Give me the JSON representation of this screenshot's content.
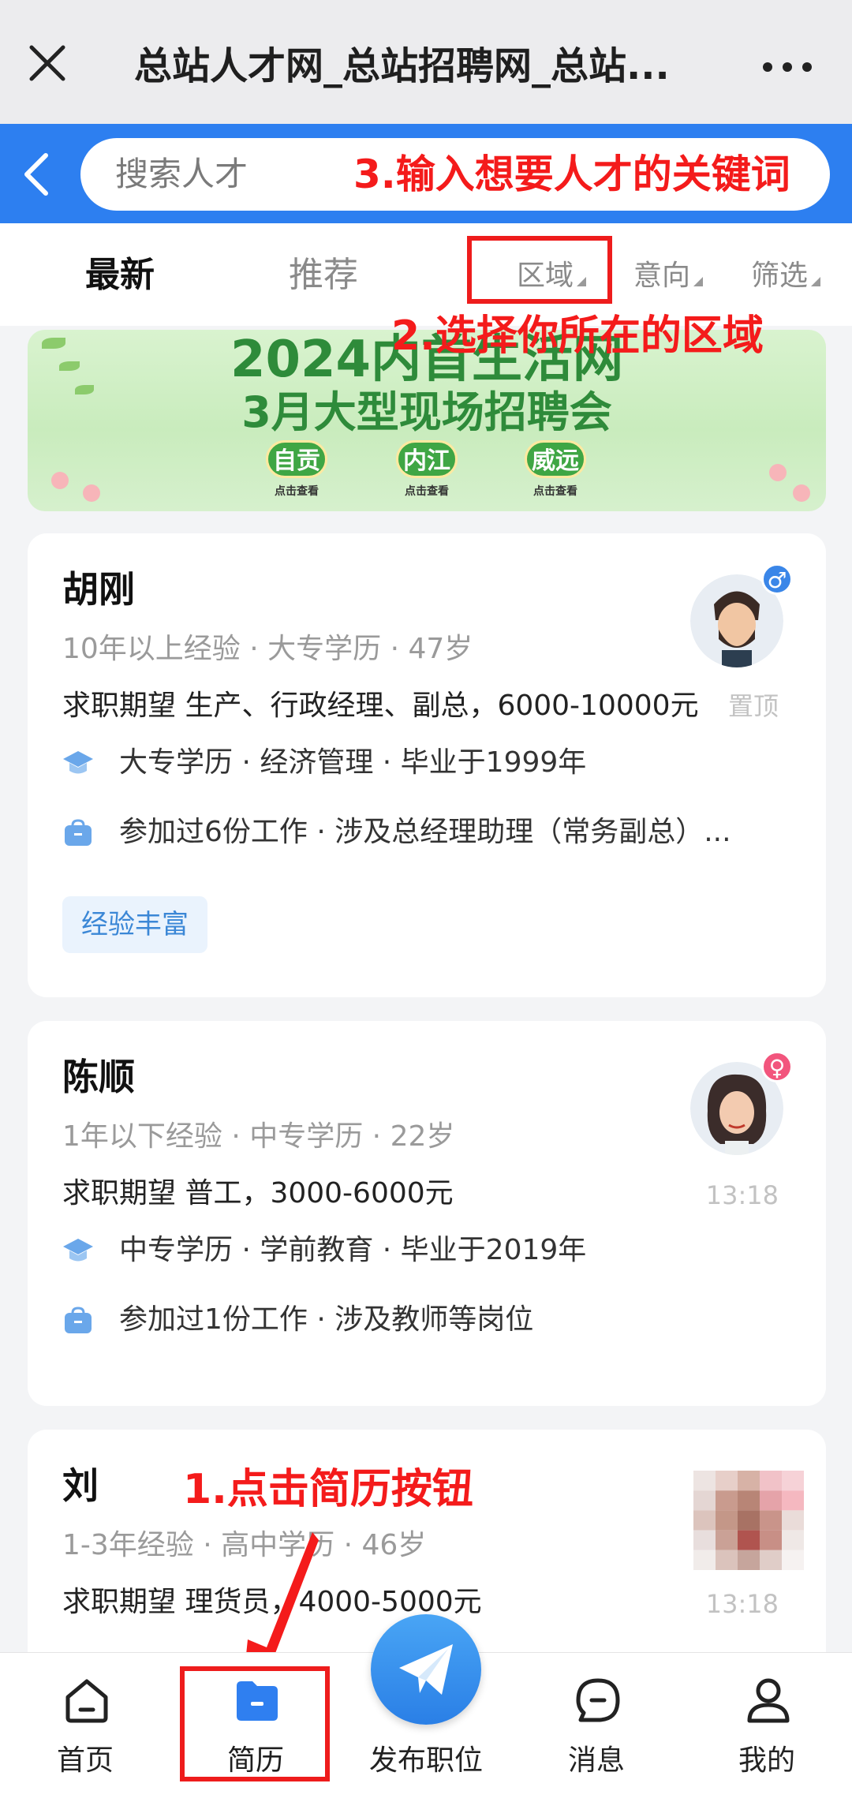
{
  "titlebar": {
    "title": "总站人才网_总站招聘网_总站..."
  },
  "search": {
    "placeholder": "搜索人才"
  },
  "tabs": {
    "latest": "最新",
    "recommended": "推荐"
  },
  "filters": {
    "area": "区域",
    "intent": "意向",
    "screen": "筛选"
  },
  "annotations": {
    "step1": "1.点击简历按钮",
    "step2": "2.选择你所在的区域",
    "step3": "3.输入想要人才的关键词"
  },
  "banner": {
    "line1": "2024内首生活网",
    "line2": "3月大型现场招聘会",
    "cities": [
      "自贡",
      "内江",
      "威远"
    ],
    "city_sub": "点击查看"
  },
  "candidates": [
    {
      "name": "胡刚",
      "meta": "10年以上经验 · 大专学历 · 47岁",
      "expect": "求职期望 生产、行政经理、副总，6000-10000元",
      "status": "置顶",
      "education": "大专学历 · 经济管理 · 毕业于1999年",
      "work": "参加过6份工作 · 涉及总经理助理（常务副总）...",
      "tag": "经验丰富",
      "gender": "♂"
    },
    {
      "name": "陈顺",
      "meta": "1年以下经验 · 中专学历 · 22岁",
      "expect": "求职期望 普工，3000-6000元",
      "status": "13:18",
      "education": "中专学历 · 学前教育 · 毕业于2019年",
      "work": "参加过1份工作 · 涉及教师等岗位",
      "gender": "♀"
    },
    {
      "name": "刘",
      "meta": "1-3年经验 · 高中学历 · 46岁",
      "expect": "求职期望 理货员，4000-5000元",
      "status": "13:18"
    }
  ],
  "bottom_nav": {
    "home": "首页",
    "resume": "简历",
    "post": "发布职位",
    "messages": "消息",
    "me": "我的"
  },
  "colors": {
    "primary": "#2d7ff0",
    "annotation": "#f41b1b",
    "banner_green": "#2e8b3a"
  }
}
